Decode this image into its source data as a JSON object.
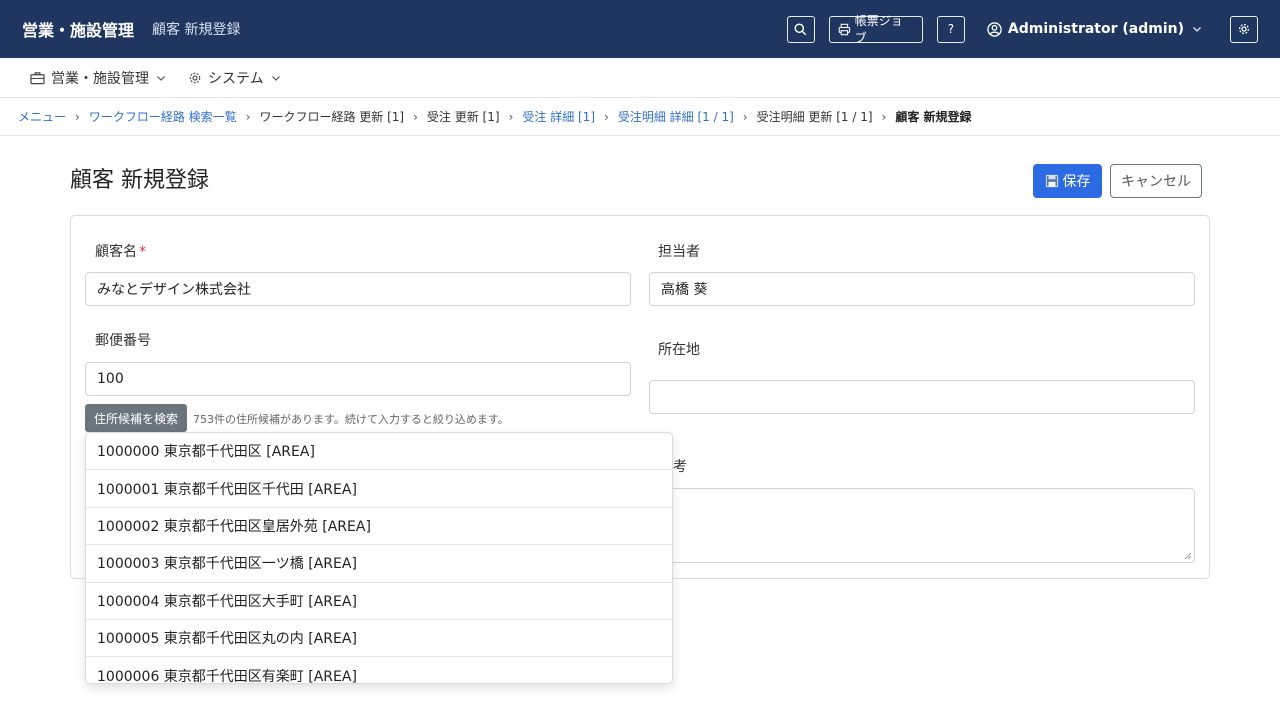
{
  "header": {
    "brand": "営業・施設管理",
    "page_subtitle": "顧客 新規登録",
    "job_button_label": "帳票ジョブ",
    "help_label": "?",
    "user_label": "Administrator (admin)"
  },
  "subnav": {
    "items": [
      {
        "label": "営業・施設管理",
        "icon": "briefcase-icon"
      },
      {
        "label": "システム",
        "icon": "gear-icon"
      }
    ]
  },
  "breadcrumb": {
    "items": [
      {
        "label": "メニュー",
        "link": true
      },
      {
        "label": "ワークフロー経路 検索一覧",
        "link": true
      },
      {
        "label": "ワークフロー経路 更新 [1]",
        "link": false
      },
      {
        "label": "受注 更新 [1]",
        "link": false
      },
      {
        "label": "受注 詳細 [1]",
        "link": true
      },
      {
        "label": "受注明細 詳細 [1 / 1]",
        "link": true
      },
      {
        "label": "受注明細 更新 [1 / 1]",
        "link": false
      },
      {
        "label": "顧客 新規登録",
        "current": true
      }
    ]
  },
  "main": {
    "title": "顧客 新規登録",
    "save_label": "保存",
    "cancel_label": "キャンセル"
  },
  "form": {
    "customer_name": {
      "label": "顧客名",
      "required_mark": "*",
      "value": "みなとデザイン株式会社"
    },
    "person_in_charge": {
      "label": "担当者",
      "value": "高橋 葵"
    },
    "postal_code": {
      "label": "郵便番号",
      "value": "100"
    },
    "address": {
      "label": "所在地",
      "value": ""
    },
    "notes": {
      "label_visible": "考",
      "value": ""
    },
    "address_search_label": "住所候補を検索",
    "address_hint": "753件の住所候補があります。続けて入力すると絞り込めます。"
  },
  "address_suggestions": [
    "1000000 東京都千代田区 [AREA]",
    "1000001 東京都千代田区千代田 [AREA]",
    "1000002 東京都千代田区皇居外苑 [AREA]",
    "1000003 東京都千代田区一ツ橋 [AREA]",
    "1000004 東京都千代田区大手町 [AREA]",
    "1000005 東京都千代田区丸の内 [AREA]",
    "1000006 東京都千代田区有楽町 [AREA]"
  ],
  "colors": {
    "topbar": "#1f3660",
    "primary": "#2d6be4",
    "link": "#2f6fd6",
    "required": "#dc3545",
    "secondary": "#6c757d"
  }
}
